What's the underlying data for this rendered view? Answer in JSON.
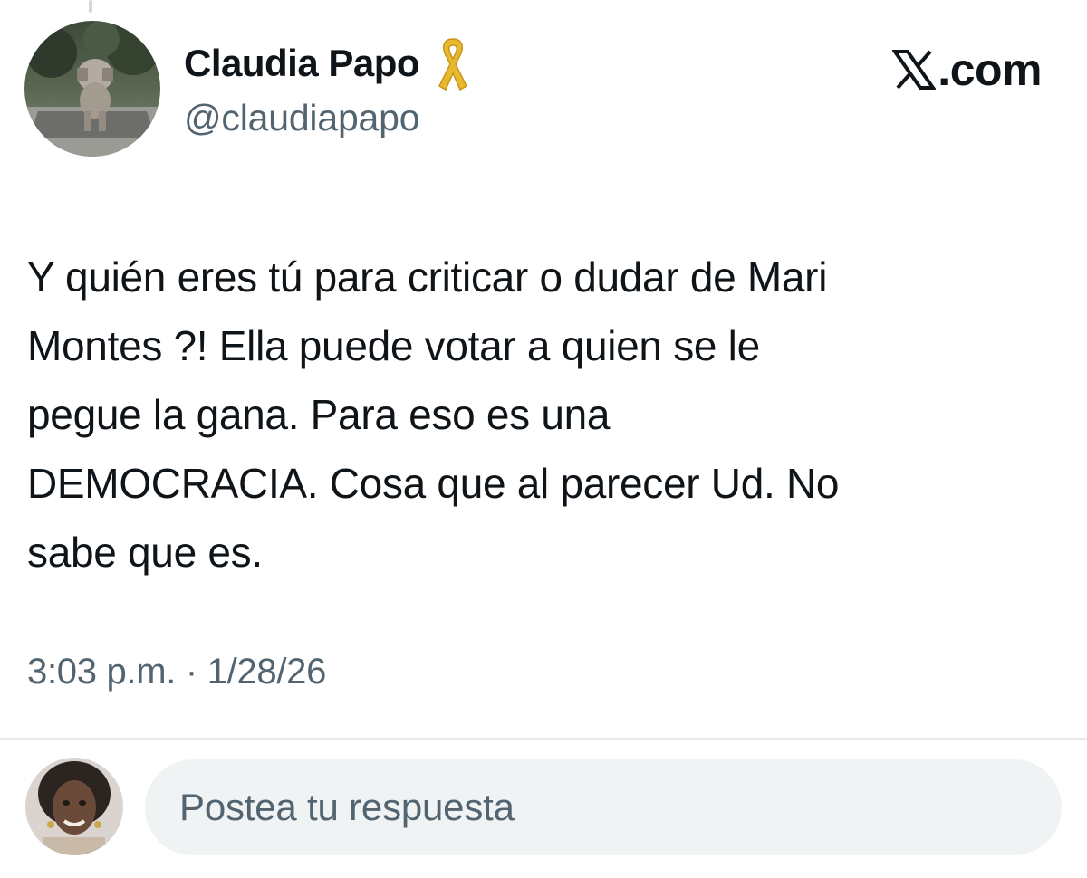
{
  "tweet": {
    "author": {
      "display_name": "Claudia Papo",
      "handle": "@claudiapapo",
      "badge_icon": "yellow-ribbon-icon",
      "avatar_icon": "profile-photo-sculpture"
    },
    "brand": {
      "label": ".com",
      "icon": "x-logo-icon"
    },
    "text": "Y quién eres tú para criticar o dudar de Mari\nMontes ?! Ella puede votar a quien se le\npegue la gana. Para eso es una\nDEMOCRACIA. Cosa que al parecer Ud. No\nsabe que es.",
    "timestamp": "3:03 p.m. · 1/28/26"
  },
  "reply": {
    "placeholder": "Postea tu respuesta",
    "avatar_icon": "current-user-avatar"
  },
  "colors": {
    "text_primary": "#0f1419",
    "text_secondary": "#536471",
    "input_bg": "#eff3f4",
    "ribbon": "#e8b92e",
    "divider": "#e4e9ec"
  }
}
